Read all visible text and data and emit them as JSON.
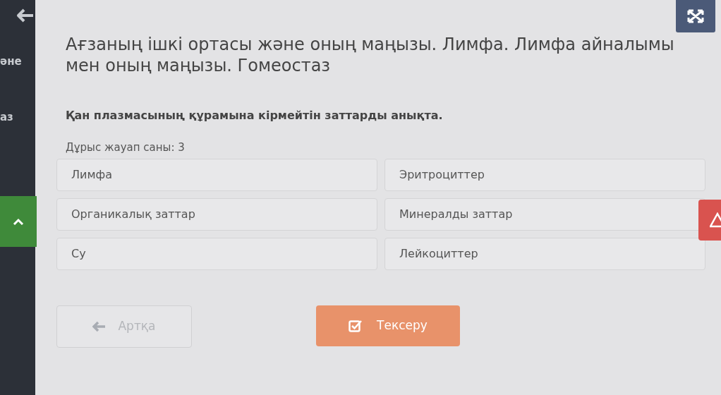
{
  "sidebar": {
    "items": [
      {
        "label": "әне"
      },
      {
        "label": "аз"
      }
    ]
  },
  "title": "Ағзаның ішкі ортасы және оның маңызы. Лимфа. Лимфа айналымы мен оның маңызы. Гомеостаз",
  "question": "Қан плазмасының құрамына кірмейтін заттарды анықта.",
  "answer_count": "Дұрыс жауап саны: 3",
  "options": [
    {
      "label": "Лимфа",
      "selected": false
    },
    {
      "label": "Эритроциттер",
      "selected": false
    },
    {
      "label": "Органикалық заттар",
      "selected": false
    },
    {
      "label": "Минералды заттар",
      "selected": false
    },
    {
      "label": "Су",
      "selected": false
    },
    {
      "label": "Лейкоциттер",
      "selected": false
    }
  ],
  "buttons": [
    {
      "kind": "back",
      "label": "Артқа",
      "disabled": true
    },
    {
      "kind": "check",
      "label": "Тексеру",
      "disabled": false
    }
  ]
}
